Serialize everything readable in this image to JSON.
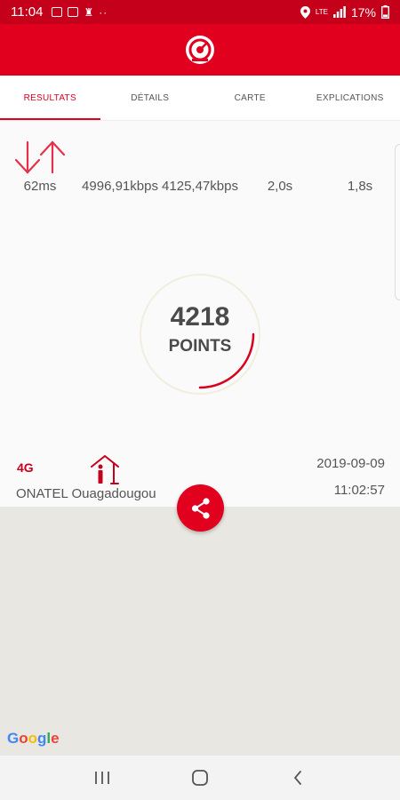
{
  "statusbar": {
    "time": "11:04",
    "dots": "··",
    "network": "LTE",
    "battery": "17%"
  },
  "tabs": [
    {
      "label": "RESULTATS",
      "active": true
    },
    {
      "label": "DÉTAILS",
      "active": false
    },
    {
      "label": "CARTE",
      "active": false
    },
    {
      "label": "EXPLICATIONS",
      "active": false
    }
  ],
  "metrics": {
    "ping": "62ms",
    "download": "4996,91kbps",
    "upload": "4125,47kbps",
    "time_a": "2,0s",
    "time_b": "1,8s"
  },
  "score": {
    "value": "4218",
    "label": "POINTS",
    "progress": 0.25
  },
  "connection": {
    "network_type": "4G",
    "operator": "ONATEL Ouagadougou",
    "date": "2019-09-09",
    "time": "11:02:57"
  },
  "map": {
    "attribution": "Google"
  },
  "colors": {
    "brand": "#e2001f",
    "statusbar": "#c4001a",
    "text": "#555555"
  },
  "icons": {
    "logo": "speedometer-icon",
    "share": "share-icon",
    "transfer": "up-down-arrows-icon",
    "indoor": "indoor-person-icon"
  }
}
